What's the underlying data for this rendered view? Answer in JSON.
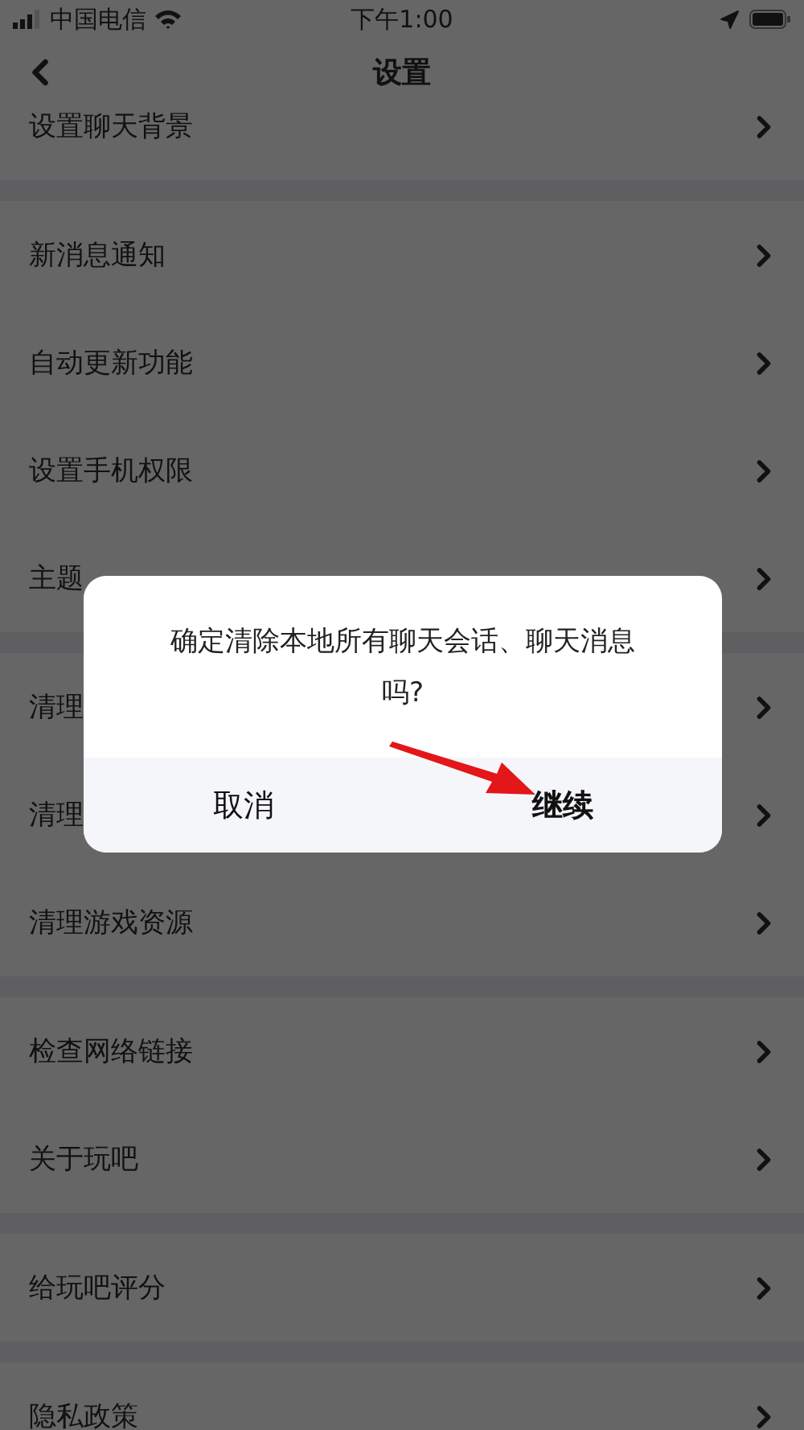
{
  "status_bar": {
    "carrier": "中国电信",
    "time": "下午1:00"
  },
  "nav": {
    "title": "设置"
  },
  "sections": [
    {
      "items": [
        {
          "label": "设置聊天背景"
        }
      ]
    },
    {
      "items": [
        {
          "label": "新消息通知"
        },
        {
          "label": "自动更新功能"
        },
        {
          "label": "设置手机权限"
        },
        {
          "label": "主题"
        }
      ]
    },
    {
      "items": [
        {
          "label": "清理"
        },
        {
          "label": "清理"
        },
        {
          "label": "清理游戏资源"
        }
      ]
    },
    {
      "items": [
        {
          "label": "检查网络链接"
        },
        {
          "label": "关于玩吧"
        }
      ]
    },
    {
      "items": [
        {
          "label": "给玩吧评分"
        }
      ]
    },
    {
      "items": [
        {
          "label": "隐私政策"
        }
      ]
    }
  ],
  "dialog": {
    "message": "确定清除本地所有聊天会话、聊天消息吗?",
    "buttons": [
      {
        "label": "取消"
      },
      {
        "label": "继续"
      }
    ]
  }
}
